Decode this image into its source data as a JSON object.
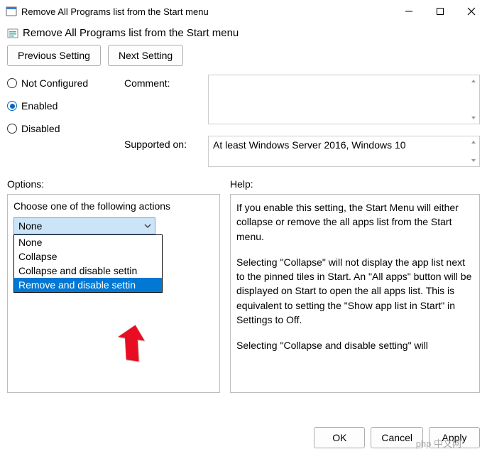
{
  "window": {
    "title": "Remove All Programs list from the Start menu"
  },
  "policy": {
    "title": "Remove All Programs list from the Start menu"
  },
  "nav": {
    "prev": "Previous Setting",
    "next": "Next Setting"
  },
  "state": {
    "not_configured": "Not Configured",
    "enabled": "Enabled",
    "disabled": "Disabled",
    "selected": "enabled"
  },
  "meta": {
    "comment_label": "Comment:",
    "comment_value": "",
    "supported_label": "Supported on:",
    "supported_value": "At least Windows Server 2016, Windows 10"
  },
  "panels": {
    "options_label": "Options:",
    "help_label": "Help:"
  },
  "options": {
    "choose_label": "Choose one of the following actions",
    "selected": "None",
    "items": [
      "None",
      "Collapse",
      "Collapse and disable settin",
      "Remove and disable settin"
    ],
    "highlighted_index": 3
  },
  "help": {
    "p1": "If you enable this setting, the Start Menu will either collapse or remove the all apps list from the Start menu.",
    "p2": "Selecting \"Collapse\" will not display the app list next to the pinned tiles in Start. An \"All apps\" button will be displayed on Start to open the all apps list. This is equivalent to setting the \"Show app list in Start\" in Settings to Off.",
    "p3": "Selecting \"Collapse and disable setting\" will"
  },
  "buttons": {
    "ok": "OK",
    "cancel": "Cancel",
    "apply": "Apply"
  },
  "watermark": "php 中文网"
}
